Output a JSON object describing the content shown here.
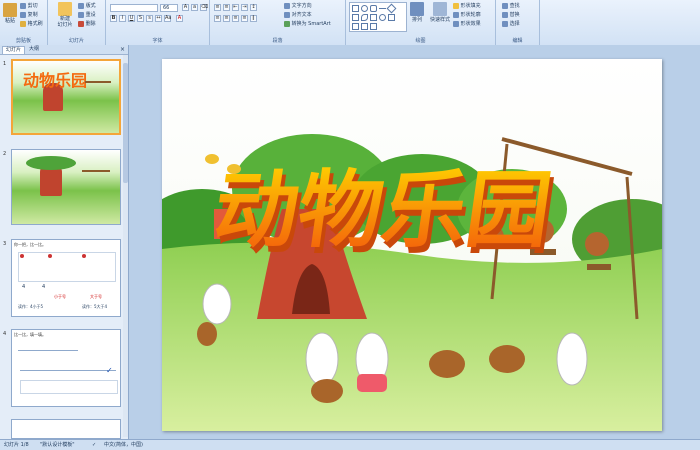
{
  "ribbon": {
    "clipboard": {
      "label": "剪贴板",
      "paste": "粘贴",
      "cut": "剪切",
      "copy": "复制",
      "format_painter": "格式刷"
    },
    "slides": {
      "label": "幻灯片",
      "new_slide": "新建\n幻灯片",
      "layout": "版式",
      "reset": "重设",
      "delete": "删除"
    },
    "font": {
      "label": "字体",
      "font_name": "",
      "font_size": "66"
    },
    "paragraph": {
      "label": "段落",
      "text_direction": "文字方向",
      "align_text": "对齐文本",
      "smartart": "转换为 SmartArt"
    },
    "drawing": {
      "label": "绘图",
      "arrange": "排列",
      "quick_styles": "快速样式",
      "fill": "形状填充",
      "outline": "形状轮廓",
      "effects": "形状效果"
    },
    "editing": {
      "label": "编辑",
      "find": "查找",
      "replace": "替换",
      "select": "选择"
    }
  },
  "panel": {
    "tab_slides": "幻灯片",
    "tab_outline": "大纲",
    "close": "×",
    "thumbnails": [
      {
        "num": "1",
        "title": "动物乐园"
      },
      {
        "num": "2",
        "title": ""
      },
      {
        "num": "3",
        "title": "",
        "labels": [
          "你一把，比一比。",
          "4",
          "4",
          "小于号",
          "大于号",
          "读作：4小于5",
          "读作：5大于4"
        ]
      },
      {
        "num": "4",
        "title": "",
        "labels": [
          "比一比，填一填。"
        ]
      }
    ]
  },
  "slide": {
    "title": "动物乐园"
  },
  "status": {
    "slide_info": "幻灯片 1/8",
    "theme": "\"默认设计模板\"",
    "language": "中文(简体，中国)"
  },
  "colors": {
    "ribbon_bg": "#dbe7f6",
    "accent": "#f4a53a",
    "title_orange": "#f46a10"
  }
}
